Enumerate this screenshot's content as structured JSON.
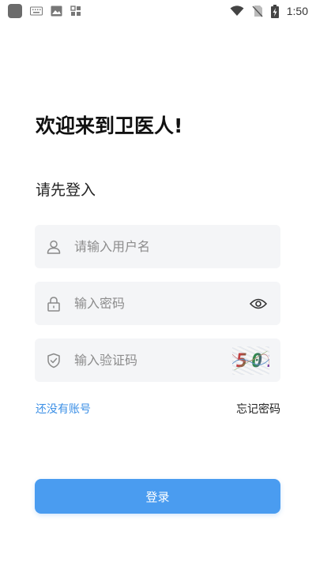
{
  "status_bar": {
    "time": "1:50",
    "left_icons": [
      "app-icon",
      "keyboard-icon",
      "image-icon",
      "widgets-icon"
    ],
    "right_icons": [
      "wifi-icon",
      "no-sim-icon",
      "battery-charging-icon"
    ]
  },
  "header": {
    "welcome": "欢迎来到卫医人!",
    "subtitle": "请先登入"
  },
  "form": {
    "username": {
      "placeholder": "请输入用户名",
      "value": "",
      "icon": "user-icon"
    },
    "password": {
      "placeholder": "输入密码",
      "value": "",
      "icon": "lock-icon",
      "toggle_icon": "eye-icon"
    },
    "captcha": {
      "placeholder": "输入验证码",
      "value": "",
      "icon": "shield-icon",
      "image_text": "8501"
    }
  },
  "links": {
    "register": "还没有账号",
    "forgot": "忘记密码"
  },
  "login_button": "登录",
  "colors": {
    "accent": "#4a9cf0",
    "link": "#3b8fe6",
    "field_bg": "#f4f5f7"
  }
}
